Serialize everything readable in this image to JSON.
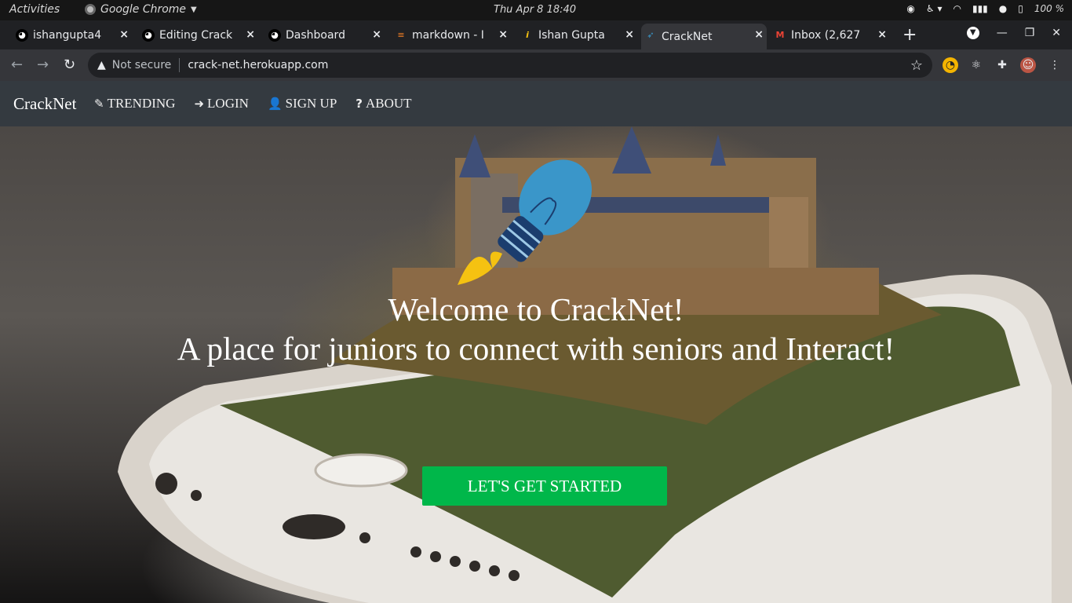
{
  "system_bar": {
    "activities": "Activities",
    "app_name": "Google Chrome",
    "clock": "Thu Apr 8  18:40",
    "battery": "100 %"
  },
  "tabs": [
    {
      "title": "ishangupta4",
      "favicon": "github-icon"
    },
    {
      "title": "Editing Crack",
      "favicon": "github-icon"
    },
    {
      "title": "Dashboard",
      "favicon": "github-icon"
    },
    {
      "title": "markdown - I",
      "favicon": "stackoverflow-icon"
    },
    {
      "title": "Ishan Gupta",
      "favicon": "info-icon"
    },
    {
      "title": "CrackNet",
      "favicon": "rocket-icon",
      "active": true
    },
    {
      "title": "Inbox (2,627",
      "favicon": "gmail-icon"
    }
  ],
  "address_bar": {
    "security": "Not secure",
    "url": "crack-net.herokuapp.com"
  },
  "site": {
    "brand": "CrackNet",
    "nav": [
      {
        "label": "TRENDING",
        "icon": "blog-icon"
      },
      {
        "label": "LOGIN",
        "icon": "sign-in-icon"
      },
      {
        "label": "SIGN UP",
        "icon": "user-plus-icon"
      },
      {
        "label": "ABOUT",
        "icon": "question-icon"
      }
    ],
    "hero": {
      "line1": "Welcome to CrackNet!",
      "line2": "A place for juniors to connect with seniors and Interact!",
      "cta": "LET'S  GET STARTED"
    }
  },
  "colors": {
    "navbar_bg": "#343a40",
    "cta_bg": "#00b74a",
    "bulb_blue": "#3a96c9",
    "flame_yellow": "#f5c211"
  }
}
